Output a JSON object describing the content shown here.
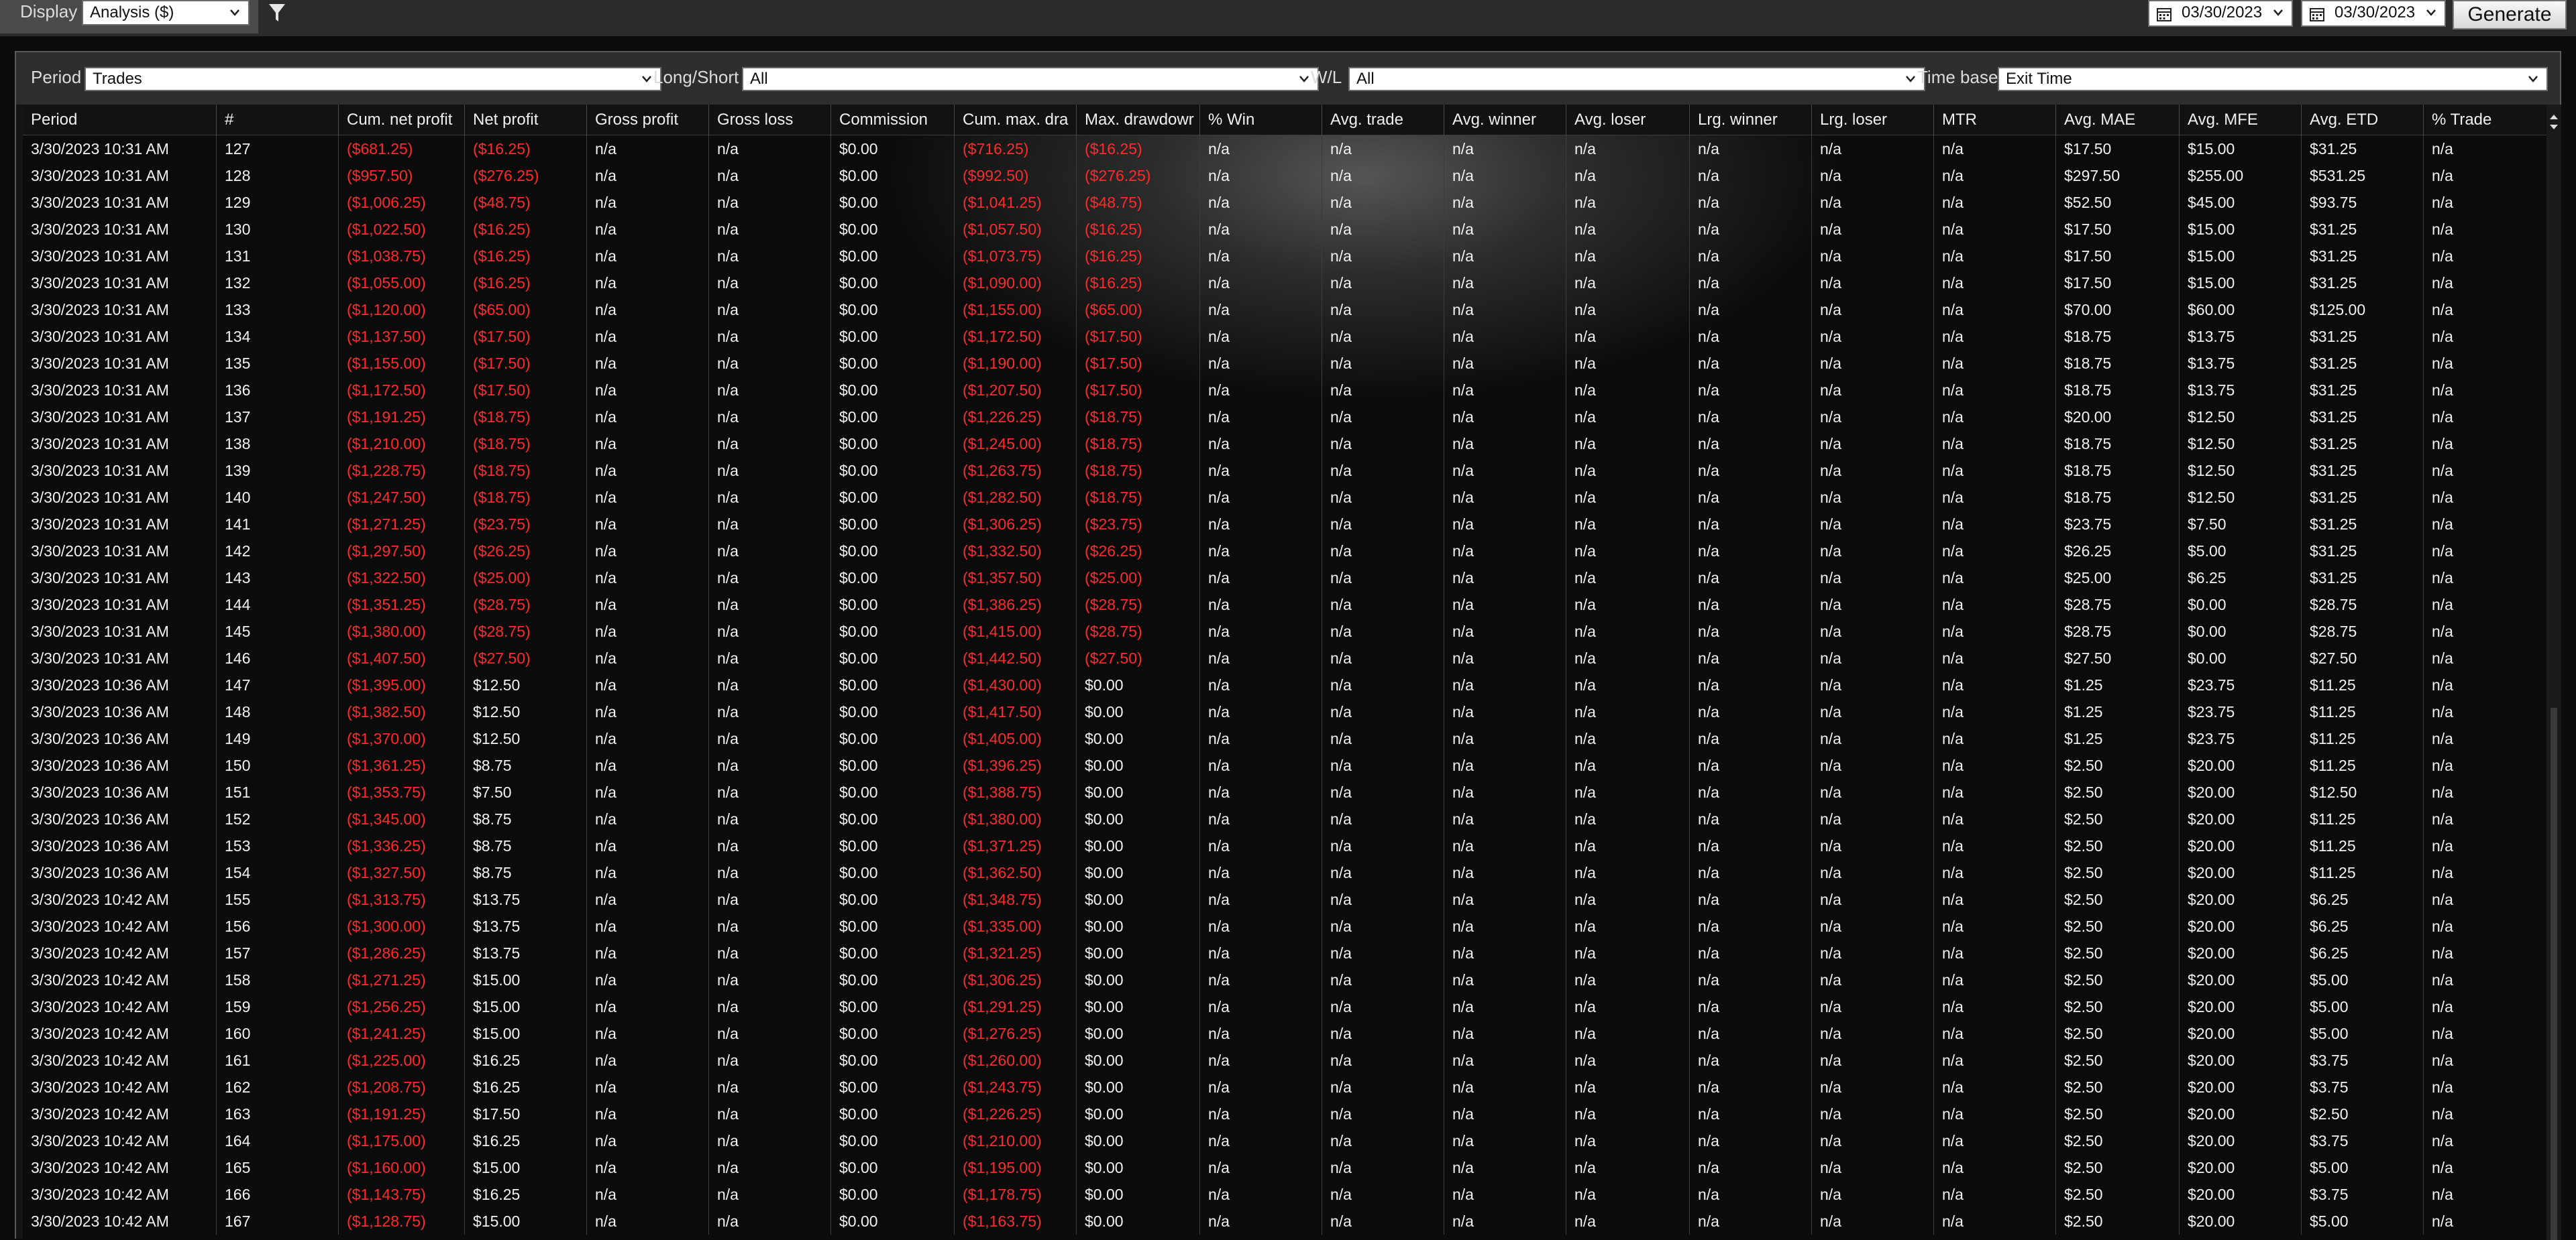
{
  "toolbar": {
    "display_label": "Display",
    "display_value": "Analysis ($)",
    "date_from": "03/30/2023",
    "date_to": "03/30/2023",
    "generate_label": "Generate"
  },
  "filters": {
    "period_label": "Period",
    "period_value": "Trades",
    "longshort_label": "Long/Short",
    "longshort_value": "All",
    "wl_label": "W/L",
    "wl_value": "All",
    "timebase_label": "Time base",
    "timebase_value": "Exit Time"
  },
  "columns": [
    "Period",
    "#",
    "Cum. net profit",
    "Net profit",
    "Gross profit",
    "Gross loss",
    "Commission",
    "Cum. max. dra",
    "Max. drawdowr",
    "% Win",
    "Avg. trade",
    "Avg. winner",
    "Avg. loser",
    "Lrg. winner",
    "Lrg. loser",
    "MTR",
    "Avg. MAE",
    "Avg. MFE",
    "Avg. ETD",
    "% Trade"
  ],
  "rows": [
    [
      "3/30/2023 10:31 AM",
      "127",
      "($681.25)",
      "($16.25)",
      "n/a",
      "n/a",
      "$0.00",
      "($716.25)",
      "($16.25)",
      "n/a",
      "n/a",
      "n/a",
      "n/a",
      "n/a",
      "n/a",
      "n/a",
      "$17.50",
      "$15.00",
      "$31.25",
      "n/a"
    ],
    [
      "3/30/2023 10:31 AM",
      "128",
      "($957.50)",
      "($276.25)",
      "n/a",
      "n/a",
      "$0.00",
      "($992.50)",
      "($276.25)",
      "n/a",
      "n/a",
      "n/a",
      "n/a",
      "n/a",
      "n/a",
      "n/a",
      "$297.50",
      "$255.00",
      "$531.25",
      "n/a"
    ],
    [
      "3/30/2023 10:31 AM",
      "129",
      "($1,006.25)",
      "($48.75)",
      "n/a",
      "n/a",
      "$0.00",
      "($1,041.25)",
      "($48.75)",
      "n/a",
      "n/a",
      "n/a",
      "n/a",
      "n/a",
      "n/a",
      "n/a",
      "$52.50",
      "$45.00",
      "$93.75",
      "n/a"
    ],
    [
      "3/30/2023 10:31 AM",
      "130",
      "($1,022.50)",
      "($16.25)",
      "n/a",
      "n/a",
      "$0.00",
      "($1,057.50)",
      "($16.25)",
      "n/a",
      "n/a",
      "n/a",
      "n/a",
      "n/a",
      "n/a",
      "n/a",
      "$17.50",
      "$15.00",
      "$31.25",
      "n/a"
    ],
    [
      "3/30/2023 10:31 AM",
      "131",
      "($1,038.75)",
      "($16.25)",
      "n/a",
      "n/a",
      "$0.00",
      "($1,073.75)",
      "($16.25)",
      "n/a",
      "n/a",
      "n/a",
      "n/a",
      "n/a",
      "n/a",
      "n/a",
      "$17.50",
      "$15.00",
      "$31.25",
      "n/a"
    ],
    [
      "3/30/2023 10:31 AM",
      "132",
      "($1,055.00)",
      "($16.25)",
      "n/a",
      "n/a",
      "$0.00",
      "($1,090.00)",
      "($16.25)",
      "n/a",
      "n/a",
      "n/a",
      "n/a",
      "n/a",
      "n/a",
      "n/a",
      "$17.50",
      "$15.00",
      "$31.25",
      "n/a"
    ],
    [
      "3/30/2023 10:31 AM",
      "133",
      "($1,120.00)",
      "($65.00)",
      "n/a",
      "n/a",
      "$0.00",
      "($1,155.00)",
      "($65.00)",
      "n/a",
      "n/a",
      "n/a",
      "n/a",
      "n/a",
      "n/a",
      "n/a",
      "$70.00",
      "$60.00",
      "$125.00",
      "n/a"
    ],
    [
      "3/30/2023 10:31 AM",
      "134",
      "($1,137.50)",
      "($17.50)",
      "n/a",
      "n/a",
      "$0.00",
      "($1,172.50)",
      "($17.50)",
      "n/a",
      "n/a",
      "n/a",
      "n/a",
      "n/a",
      "n/a",
      "n/a",
      "$18.75",
      "$13.75",
      "$31.25",
      "n/a"
    ],
    [
      "3/30/2023 10:31 AM",
      "135",
      "($1,155.00)",
      "($17.50)",
      "n/a",
      "n/a",
      "$0.00",
      "($1,190.00)",
      "($17.50)",
      "n/a",
      "n/a",
      "n/a",
      "n/a",
      "n/a",
      "n/a",
      "n/a",
      "$18.75",
      "$13.75",
      "$31.25",
      "n/a"
    ],
    [
      "3/30/2023 10:31 AM",
      "136",
      "($1,172.50)",
      "($17.50)",
      "n/a",
      "n/a",
      "$0.00",
      "($1,207.50)",
      "($17.50)",
      "n/a",
      "n/a",
      "n/a",
      "n/a",
      "n/a",
      "n/a",
      "n/a",
      "$18.75",
      "$13.75",
      "$31.25",
      "n/a"
    ],
    [
      "3/30/2023 10:31 AM",
      "137",
      "($1,191.25)",
      "($18.75)",
      "n/a",
      "n/a",
      "$0.00",
      "($1,226.25)",
      "($18.75)",
      "n/a",
      "n/a",
      "n/a",
      "n/a",
      "n/a",
      "n/a",
      "n/a",
      "$20.00",
      "$12.50",
      "$31.25",
      "n/a"
    ],
    [
      "3/30/2023 10:31 AM",
      "138",
      "($1,210.00)",
      "($18.75)",
      "n/a",
      "n/a",
      "$0.00",
      "($1,245.00)",
      "($18.75)",
      "n/a",
      "n/a",
      "n/a",
      "n/a",
      "n/a",
      "n/a",
      "n/a",
      "$18.75",
      "$12.50",
      "$31.25",
      "n/a"
    ],
    [
      "3/30/2023 10:31 AM",
      "139",
      "($1,228.75)",
      "($18.75)",
      "n/a",
      "n/a",
      "$0.00",
      "($1,263.75)",
      "($18.75)",
      "n/a",
      "n/a",
      "n/a",
      "n/a",
      "n/a",
      "n/a",
      "n/a",
      "$18.75",
      "$12.50",
      "$31.25",
      "n/a"
    ],
    [
      "3/30/2023 10:31 AM",
      "140",
      "($1,247.50)",
      "($18.75)",
      "n/a",
      "n/a",
      "$0.00",
      "($1,282.50)",
      "($18.75)",
      "n/a",
      "n/a",
      "n/a",
      "n/a",
      "n/a",
      "n/a",
      "n/a",
      "$18.75",
      "$12.50",
      "$31.25",
      "n/a"
    ],
    [
      "3/30/2023 10:31 AM",
      "141",
      "($1,271.25)",
      "($23.75)",
      "n/a",
      "n/a",
      "$0.00",
      "($1,306.25)",
      "($23.75)",
      "n/a",
      "n/a",
      "n/a",
      "n/a",
      "n/a",
      "n/a",
      "n/a",
      "$23.75",
      "$7.50",
      "$31.25",
      "n/a"
    ],
    [
      "3/30/2023 10:31 AM",
      "142",
      "($1,297.50)",
      "($26.25)",
      "n/a",
      "n/a",
      "$0.00",
      "($1,332.50)",
      "($26.25)",
      "n/a",
      "n/a",
      "n/a",
      "n/a",
      "n/a",
      "n/a",
      "n/a",
      "$26.25",
      "$5.00",
      "$31.25",
      "n/a"
    ],
    [
      "3/30/2023 10:31 AM",
      "143",
      "($1,322.50)",
      "($25.00)",
      "n/a",
      "n/a",
      "$0.00",
      "($1,357.50)",
      "($25.00)",
      "n/a",
      "n/a",
      "n/a",
      "n/a",
      "n/a",
      "n/a",
      "n/a",
      "$25.00",
      "$6.25",
      "$31.25",
      "n/a"
    ],
    [
      "3/30/2023 10:31 AM",
      "144",
      "($1,351.25)",
      "($28.75)",
      "n/a",
      "n/a",
      "$0.00",
      "($1,386.25)",
      "($28.75)",
      "n/a",
      "n/a",
      "n/a",
      "n/a",
      "n/a",
      "n/a",
      "n/a",
      "$28.75",
      "$0.00",
      "$28.75",
      "n/a"
    ],
    [
      "3/30/2023 10:31 AM",
      "145",
      "($1,380.00)",
      "($28.75)",
      "n/a",
      "n/a",
      "$0.00",
      "($1,415.00)",
      "($28.75)",
      "n/a",
      "n/a",
      "n/a",
      "n/a",
      "n/a",
      "n/a",
      "n/a",
      "$28.75",
      "$0.00",
      "$28.75",
      "n/a"
    ],
    [
      "3/30/2023 10:31 AM",
      "146",
      "($1,407.50)",
      "($27.50)",
      "n/a",
      "n/a",
      "$0.00",
      "($1,442.50)",
      "($27.50)",
      "n/a",
      "n/a",
      "n/a",
      "n/a",
      "n/a",
      "n/a",
      "n/a",
      "$27.50",
      "$0.00",
      "$27.50",
      "n/a"
    ],
    [
      "3/30/2023 10:36 AM",
      "147",
      "($1,395.00)",
      "$12.50",
      "n/a",
      "n/a",
      "$0.00",
      "($1,430.00)",
      "$0.00",
      "n/a",
      "n/a",
      "n/a",
      "n/a",
      "n/a",
      "n/a",
      "n/a",
      "$1.25",
      "$23.75",
      "$11.25",
      "n/a"
    ],
    [
      "3/30/2023 10:36 AM",
      "148",
      "($1,382.50)",
      "$12.50",
      "n/a",
      "n/a",
      "$0.00",
      "($1,417.50)",
      "$0.00",
      "n/a",
      "n/a",
      "n/a",
      "n/a",
      "n/a",
      "n/a",
      "n/a",
      "$1.25",
      "$23.75",
      "$11.25",
      "n/a"
    ],
    [
      "3/30/2023 10:36 AM",
      "149",
      "($1,370.00)",
      "$12.50",
      "n/a",
      "n/a",
      "$0.00",
      "($1,405.00)",
      "$0.00",
      "n/a",
      "n/a",
      "n/a",
      "n/a",
      "n/a",
      "n/a",
      "n/a",
      "$1.25",
      "$23.75",
      "$11.25",
      "n/a"
    ],
    [
      "3/30/2023 10:36 AM",
      "150",
      "($1,361.25)",
      "$8.75",
      "n/a",
      "n/a",
      "$0.00",
      "($1,396.25)",
      "$0.00",
      "n/a",
      "n/a",
      "n/a",
      "n/a",
      "n/a",
      "n/a",
      "n/a",
      "$2.50",
      "$20.00",
      "$11.25",
      "n/a"
    ],
    [
      "3/30/2023 10:36 AM",
      "151",
      "($1,353.75)",
      "$7.50",
      "n/a",
      "n/a",
      "$0.00",
      "($1,388.75)",
      "$0.00",
      "n/a",
      "n/a",
      "n/a",
      "n/a",
      "n/a",
      "n/a",
      "n/a",
      "$2.50",
      "$20.00",
      "$12.50",
      "n/a"
    ],
    [
      "3/30/2023 10:36 AM",
      "152",
      "($1,345.00)",
      "$8.75",
      "n/a",
      "n/a",
      "$0.00",
      "($1,380.00)",
      "$0.00",
      "n/a",
      "n/a",
      "n/a",
      "n/a",
      "n/a",
      "n/a",
      "n/a",
      "$2.50",
      "$20.00",
      "$11.25",
      "n/a"
    ],
    [
      "3/30/2023 10:36 AM",
      "153",
      "($1,336.25)",
      "$8.75",
      "n/a",
      "n/a",
      "$0.00",
      "($1,371.25)",
      "$0.00",
      "n/a",
      "n/a",
      "n/a",
      "n/a",
      "n/a",
      "n/a",
      "n/a",
      "$2.50",
      "$20.00",
      "$11.25",
      "n/a"
    ],
    [
      "3/30/2023 10:36 AM",
      "154",
      "($1,327.50)",
      "$8.75",
      "n/a",
      "n/a",
      "$0.00",
      "($1,362.50)",
      "$0.00",
      "n/a",
      "n/a",
      "n/a",
      "n/a",
      "n/a",
      "n/a",
      "n/a",
      "$2.50",
      "$20.00",
      "$11.25",
      "n/a"
    ],
    [
      "3/30/2023 10:42 AM",
      "155",
      "($1,313.75)",
      "$13.75",
      "n/a",
      "n/a",
      "$0.00",
      "($1,348.75)",
      "$0.00",
      "n/a",
      "n/a",
      "n/a",
      "n/a",
      "n/a",
      "n/a",
      "n/a",
      "$2.50",
      "$20.00",
      "$6.25",
      "n/a"
    ],
    [
      "3/30/2023 10:42 AM",
      "156",
      "($1,300.00)",
      "$13.75",
      "n/a",
      "n/a",
      "$0.00",
      "($1,335.00)",
      "$0.00",
      "n/a",
      "n/a",
      "n/a",
      "n/a",
      "n/a",
      "n/a",
      "n/a",
      "$2.50",
      "$20.00",
      "$6.25",
      "n/a"
    ],
    [
      "3/30/2023 10:42 AM",
      "157",
      "($1,286.25)",
      "$13.75",
      "n/a",
      "n/a",
      "$0.00",
      "($1,321.25)",
      "$0.00",
      "n/a",
      "n/a",
      "n/a",
      "n/a",
      "n/a",
      "n/a",
      "n/a",
      "$2.50",
      "$20.00",
      "$6.25",
      "n/a"
    ],
    [
      "3/30/2023 10:42 AM",
      "158",
      "($1,271.25)",
      "$15.00",
      "n/a",
      "n/a",
      "$0.00",
      "($1,306.25)",
      "$0.00",
      "n/a",
      "n/a",
      "n/a",
      "n/a",
      "n/a",
      "n/a",
      "n/a",
      "$2.50",
      "$20.00",
      "$5.00",
      "n/a"
    ],
    [
      "3/30/2023 10:42 AM",
      "159",
      "($1,256.25)",
      "$15.00",
      "n/a",
      "n/a",
      "$0.00",
      "($1,291.25)",
      "$0.00",
      "n/a",
      "n/a",
      "n/a",
      "n/a",
      "n/a",
      "n/a",
      "n/a",
      "$2.50",
      "$20.00",
      "$5.00",
      "n/a"
    ],
    [
      "3/30/2023 10:42 AM",
      "160",
      "($1,241.25)",
      "$15.00",
      "n/a",
      "n/a",
      "$0.00",
      "($1,276.25)",
      "$0.00",
      "n/a",
      "n/a",
      "n/a",
      "n/a",
      "n/a",
      "n/a",
      "n/a",
      "$2.50",
      "$20.00",
      "$5.00",
      "n/a"
    ],
    [
      "3/30/2023 10:42 AM",
      "161",
      "($1,225.00)",
      "$16.25",
      "n/a",
      "n/a",
      "$0.00",
      "($1,260.00)",
      "$0.00",
      "n/a",
      "n/a",
      "n/a",
      "n/a",
      "n/a",
      "n/a",
      "n/a",
      "$2.50",
      "$20.00",
      "$3.75",
      "n/a"
    ],
    [
      "3/30/2023 10:42 AM",
      "162",
      "($1,208.75)",
      "$16.25",
      "n/a",
      "n/a",
      "$0.00",
      "($1,243.75)",
      "$0.00",
      "n/a",
      "n/a",
      "n/a",
      "n/a",
      "n/a",
      "n/a",
      "n/a",
      "$2.50",
      "$20.00",
      "$3.75",
      "n/a"
    ],
    [
      "3/30/2023 10:42 AM",
      "163",
      "($1,191.25)",
      "$17.50",
      "n/a",
      "n/a",
      "$0.00",
      "($1,226.25)",
      "$0.00",
      "n/a",
      "n/a",
      "n/a",
      "n/a",
      "n/a",
      "n/a",
      "n/a",
      "$2.50",
      "$20.00",
      "$2.50",
      "n/a"
    ],
    [
      "3/30/2023 10:42 AM",
      "164",
      "($1,175.00)",
      "$16.25",
      "n/a",
      "n/a",
      "$0.00",
      "($1,210.00)",
      "$0.00",
      "n/a",
      "n/a",
      "n/a",
      "n/a",
      "n/a",
      "n/a",
      "n/a",
      "$2.50",
      "$20.00",
      "$3.75",
      "n/a"
    ],
    [
      "3/30/2023 10:42 AM",
      "165",
      "($1,160.00)",
      "$15.00",
      "n/a",
      "n/a",
      "$0.00",
      "($1,195.00)",
      "$0.00",
      "n/a",
      "n/a",
      "n/a",
      "n/a",
      "n/a",
      "n/a",
      "n/a",
      "$2.50",
      "$20.00",
      "$5.00",
      "n/a"
    ],
    [
      "3/30/2023 10:42 AM",
      "166",
      "($1,143.75)",
      "$16.25",
      "n/a",
      "n/a",
      "$0.00",
      "($1,178.75)",
      "$0.00",
      "n/a",
      "n/a",
      "n/a",
      "n/a",
      "n/a",
      "n/a",
      "n/a",
      "$2.50",
      "$20.00",
      "$3.75",
      "n/a"
    ],
    [
      "3/30/2023 10:42 AM",
      "167",
      "($1,128.75)",
      "$15.00",
      "n/a",
      "n/a",
      "$0.00",
      "($1,163.75)",
      "$0.00",
      "n/a",
      "n/a",
      "n/a",
      "n/a",
      "n/a",
      "n/a",
      "n/a",
      "$2.50",
      "$20.00",
      "$5.00",
      "n/a"
    ]
  ],
  "icons": {
    "filter": "filter-icon",
    "calendar": "calendar-icon",
    "dropdown": "chevron-down-icon"
  },
  "colors": {
    "negative": "#ff2a2a",
    "text": "#f2f2f2",
    "background": "#0b0b0b"
  }
}
